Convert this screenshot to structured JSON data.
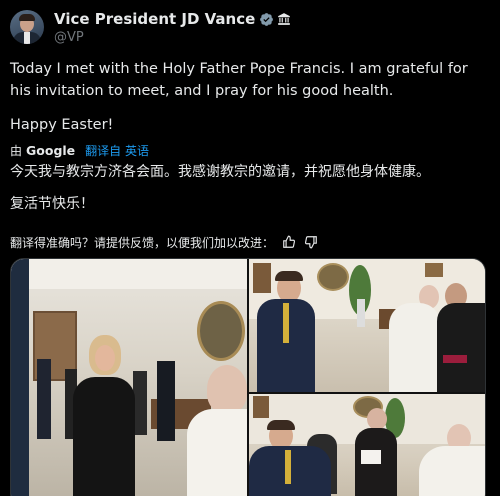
{
  "author": {
    "display_name": "Vice President JD Vance",
    "handle": "@VP",
    "verified_badge": "verified-badge-icon",
    "affiliation_badge": "government-building-icon"
  },
  "tweet": {
    "text_line1": "Today I met with the Holy Father Pope Francis. I am grateful for his invitation to meet, and I pray for his good health.",
    "text_line2": "Happy Easter!"
  },
  "translation": {
    "by": "由",
    "provider": "Google",
    "translated_from": "翻译自 英语",
    "text_line1": "今天我与教宗方济各会面。我感谢教宗的邀请，并祝愿他身体健康。",
    "text_line2": "复活节快乐！",
    "feedback_prompt": "翻译得准确吗？请提供反馈，以便我们加以改进："
  },
  "colors": {
    "background": "#000000",
    "text": "#e7e9ea",
    "muted": "#71767b",
    "link": "#1d9bf0",
    "verified": "#829aab"
  }
}
